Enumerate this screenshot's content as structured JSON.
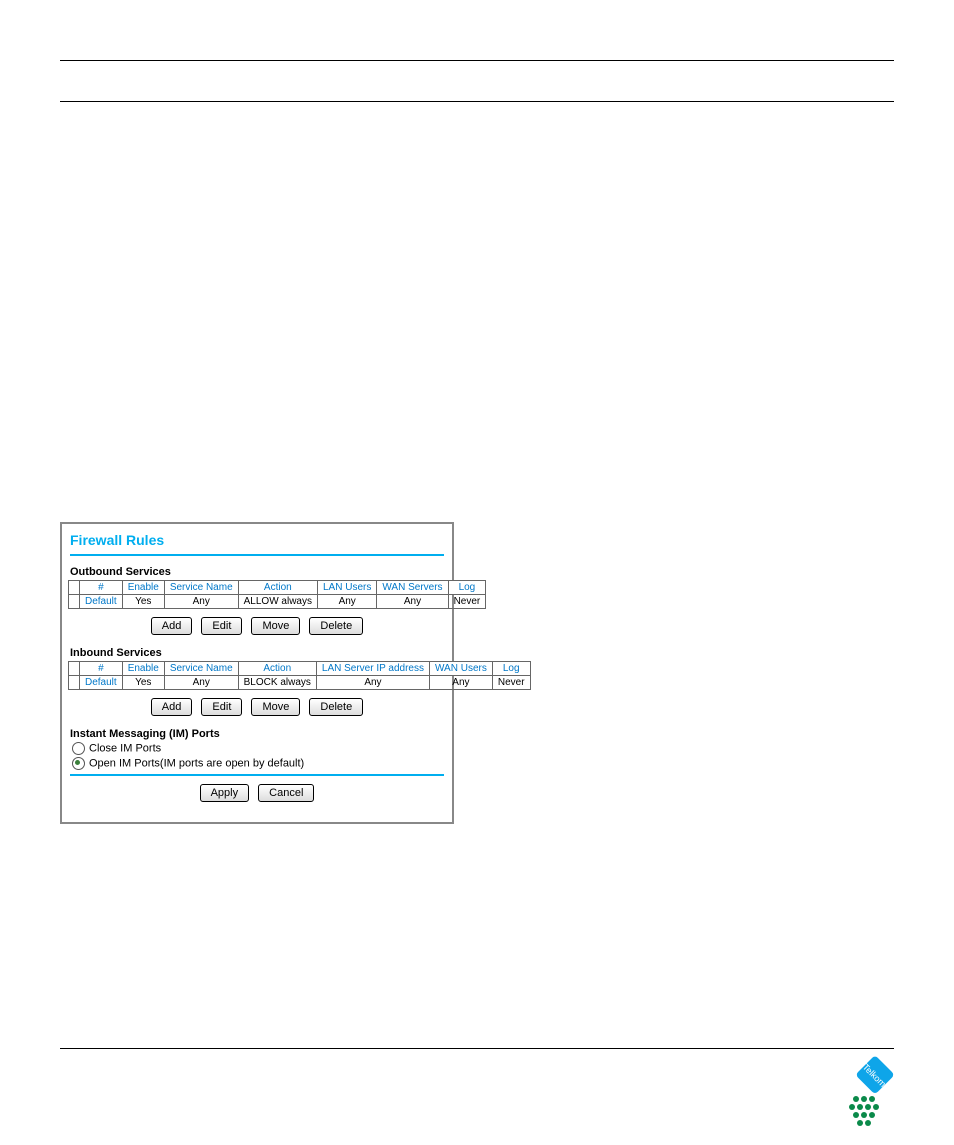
{
  "panel": {
    "title": "Firewall Rules",
    "sections": {
      "outbound": {
        "label": "Outbound Services",
        "headers": [
          "",
          "#",
          "Enable",
          "Service Name",
          "Action",
          "LAN Users",
          "WAN Servers",
          "Log"
        ],
        "row": {
          "col0": "",
          "num": "Default",
          "enable": "Yes",
          "service": "Any",
          "action": "ALLOW always",
          "lan": "Any",
          "wan": "Any",
          "log": "Never"
        }
      },
      "inbound": {
        "label": "Inbound Services",
        "headers": [
          "",
          "#",
          "Enable",
          "Service Name",
          "Action",
          "LAN Server IP address",
          "WAN Users",
          "Log"
        ],
        "row": {
          "col0": "",
          "num": "Default",
          "enable": "Yes",
          "service": "Any",
          "action": "BLOCK always",
          "lan": "Any",
          "wan": "Any",
          "log": "Never"
        }
      }
    },
    "buttons": {
      "add": "Add",
      "edit": "Edit",
      "move": "Move",
      "delete": "Delete",
      "apply": "Apply",
      "cancel": "Cancel"
    },
    "im": {
      "label": "Instant Messaging (IM) Ports",
      "close": "Close IM Ports",
      "open": "Open IM Ports",
      "open_note": "(IM ports are open by default)",
      "selected": "open"
    }
  },
  "logo": {
    "text": "Telkom"
  }
}
